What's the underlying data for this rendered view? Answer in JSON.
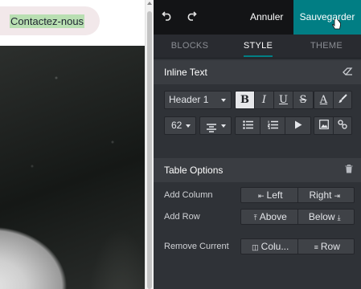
{
  "preview": {
    "cta_label": "Contactez-nous"
  },
  "topbar": {
    "undo_icon": "undo-icon",
    "redo_icon": "redo-icon",
    "cancel_label": "Annuler",
    "save_label": "Sauvegarder",
    "save_color": "#017e84"
  },
  "tabs": [
    {
      "label": "BLOCKS",
      "active": false
    },
    {
      "label": "STYLE",
      "active": true
    },
    {
      "label": "THEME",
      "active": false
    }
  ],
  "inline_text": {
    "title": "Inline Text",
    "heading_select": "Header 1",
    "font_size_select": "62",
    "bold": "B",
    "italic": "I",
    "underline": "U",
    "strike": "S",
    "font_color": "A"
  },
  "table_options": {
    "title": "Table Options",
    "add_column_label": "Add Column",
    "add_row_label": "Add Row",
    "remove_current_label": "Remove Current",
    "left_label": "Left",
    "right_label": "Right",
    "above_label": "Above",
    "below_label": "Below",
    "column_label": "Colu...",
    "row_label": "Row"
  }
}
